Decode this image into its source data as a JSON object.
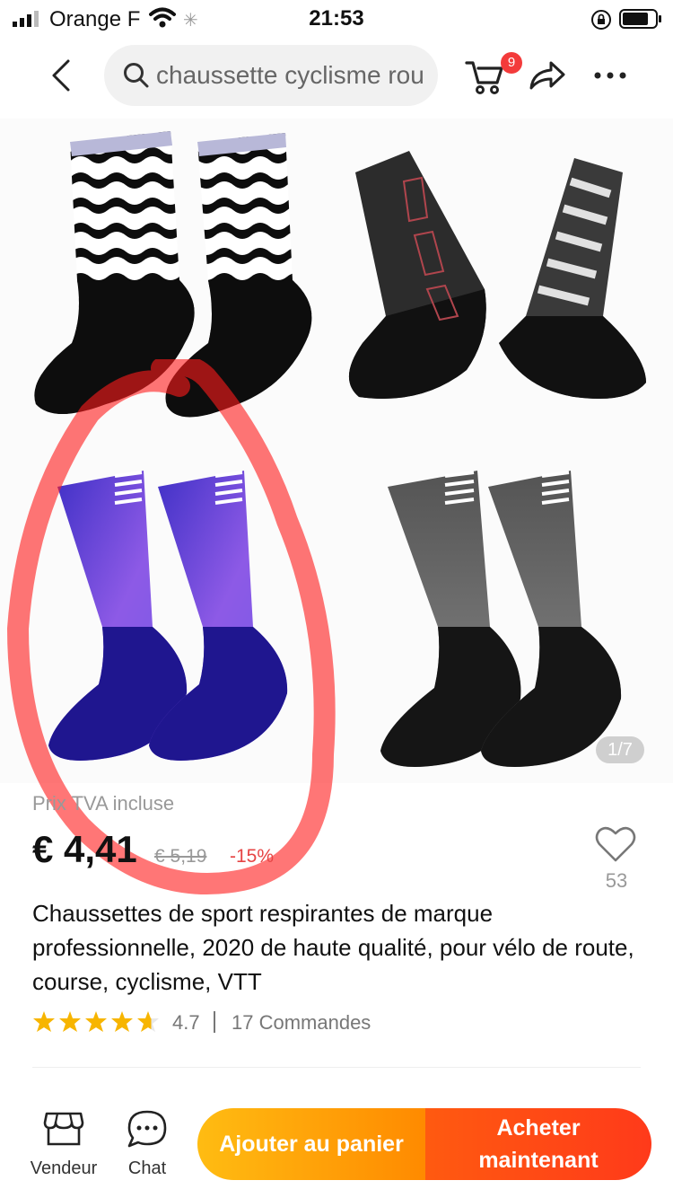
{
  "status_bar": {
    "carrier": "Orange F",
    "time": "21:53"
  },
  "search": {
    "query": "chaussette cyclisme rou",
    "cart_count": "9"
  },
  "gallery": {
    "counter": "1/7",
    "colors": {
      "wave_black": "#0d0d0d",
      "blue_top": "#7c45d8",
      "blue_bottom": "#1f168f",
      "gray_top": "#7b7b7b",
      "black_bottom": "#151515",
      "annotation": "#ff1a1a"
    }
  },
  "price": {
    "vat_label": "Prix TVA incluse",
    "current": "€ 4,41",
    "original": "€ 5,19",
    "discount": "-15%"
  },
  "wishlist": {
    "count": "53"
  },
  "product": {
    "title": "Chaussettes de sport respirantes de marque professionnelle, 2020 de haute qualité, pour vélo de route, course, cyclisme, VTT",
    "rating": "4.7",
    "rating_stars": 4.7,
    "orders": "17 Commandes"
  },
  "bottom_bar": {
    "vendor_label": "Vendeur",
    "chat_label": "Chat",
    "add_to_cart": "Ajouter au panier",
    "buy_now": "Acheter maintenant"
  },
  "icons": [
    "signal-icon",
    "wifi-icon",
    "lock-rotation-icon",
    "battery-icon",
    "back-icon",
    "search-icon",
    "cart-icon",
    "share-icon",
    "more-icon",
    "heart-icon",
    "star-icon",
    "store-icon",
    "chat-icon"
  ]
}
